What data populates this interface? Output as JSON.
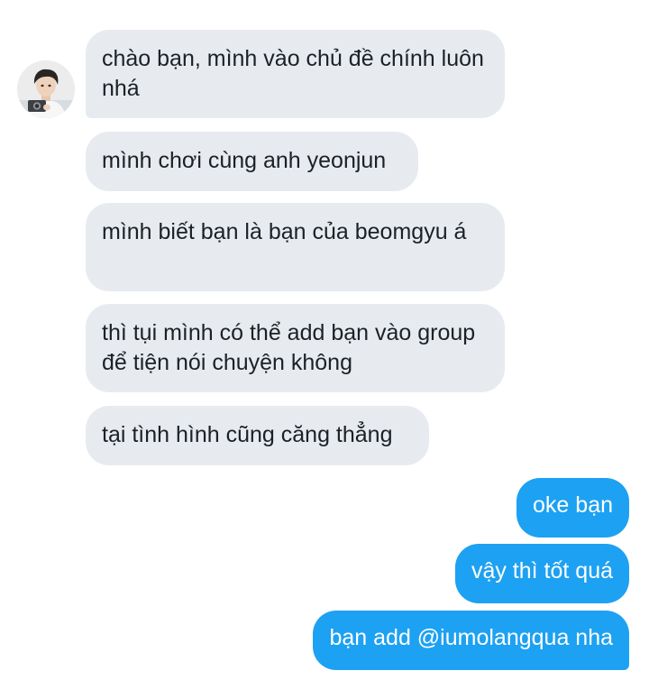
{
  "conversation": {
    "contact": {
      "avatar_icon": "contact-avatar-photo"
    },
    "incoming": [
      {
        "text": "chào bạn, mình vào chủ đề chính luôn nhá"
      },
      {
        "text": "mình chơi cùng anh yeonjun"
      },
      {
        "text": "mình biết bạn là bạn của beomgyu á"
      },
      {
        "text": "thì tụi mình có thể add bạn vào group để tiện nói chuyện không"
      },
      {
        "text": "tại tình hình cũng căng thẳng"
      }
    ],
    "outgoing": [
      {
        "text": "oke bạn"
      },
      {
        "text": "vậy thì tốt quá"
      },
      {
        "text": "bạn add @iumolangqua nha"
      }
    ]
  },
  "colors": {
    "incoming_bubble": "#e7ebef",
    "incoming_text": "#1b2126",
    "outgoing_bubble": "#1da1f2",
    "outgoing_text": "#ffffff",
    "background": "#ffffff"
  }
}
